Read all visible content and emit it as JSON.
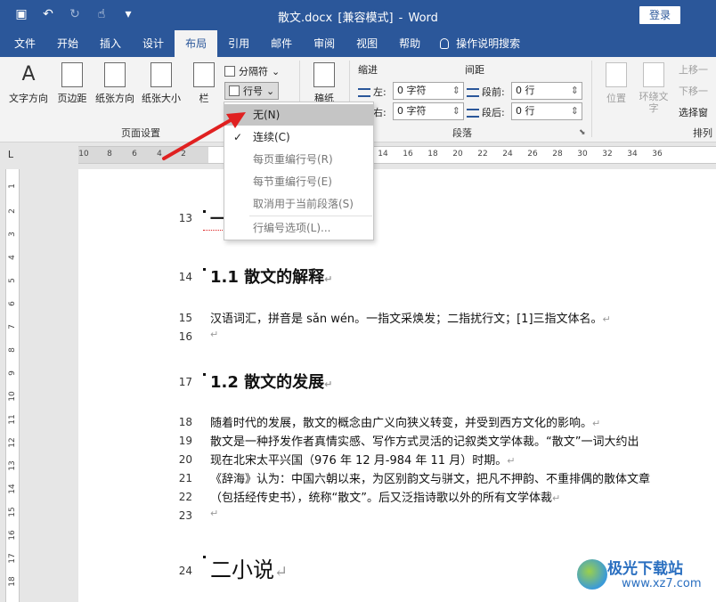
{
  "titlebar": {
    "doc_name": "散文.docx",
    "mode": "[兼容模式]",
    "separator": "-",
    "app": "Word",
    "login": "登录"
  },
  "tabs": [
    "文件",
    "开始",
    "插入",
    "设计",
    "布局",
    "引用",
    "邮件",
    "审阅",
    "视图",
    "帮助"
  ],
  "tab_search": "操作说明搜索",
  "ribbon": {
    "text_direction": "文字方向",
    "margins": "页边距",
    "orientation": "纸张方向",
    "size": "纸张大小",
    "columns": "栏",
    "breaks": "分隔符",
    "line_numbers": "行号",
    "hyphen_partial": "稿纸",
    "page_setup_label": "页面设置",
    "indent_label": "缩进",
    "spacing_label": "间距",
    "left_label": "左:",
    "right_label": "右:",
    "before_label": "段前:",
    "after_label": "段后:",
    "left_value": "0 字符",
    "right_value": "0 字符",
    "before_value": "0 行",
    "after_value": "0 行",
    "paragraph_label": "段落",
    "position": "位置",
    "wrap_text": "环绕文字",
    "bring_forward": "上移一",
    "send_backward": "下移一",
    "selection_pane": "选择窗",
    "arrange_label": "排列"
  },
  "ruler": {
    "corner": "L",
    "ticks": [
      "10",
      "8",
      "6",
      "4",
      "2",
      "14",
      "16",
      "18",
      "20",
      "22",
      "24",
      "26",
      "28",
      "30",
      "32",
      "34",
      "36"
    ],
    "vticks": [
      "1",
      "2",
      "3",
      "4",
      "5",
      "6",
      "7",
      "8",
      "9",
      "10",
      "11",
      "12",
      "13",
      "14",
      "15",
      "16",
      "17",
      "18",
      "19"
    ]
  },
  "dropdown": {
    "items": [
      {
        "label": "无(N)",
        "checked": false
      },
      {
        "label": "连续(C)",
        "checked": true
      },
      {
        "label": "每页重编行号(R)",
        "checked": false
      },
      {
        "label": "每节重编行号(E)",
        "checked": false
      },
      {
        "label": "取消用于当前段落(S)",
        "checked": false
      },
      {
        "label": "行编号选项(L)...",
        "checked": false
      }
    ]
  },
  "document": {
    "ln13": "13",
    "h13_partial": "一",
    "ln14": "14",
    "h14": "1.1 散文的解释",
    "ln15": "15",
    "p15": "汉语词汇，拼音是 sǎn wén。一指文采焕发；二指扰行文；[1]三指文体名。",
    "ln16": "16",
    "ln17": "17",
    "h17": "1.2 散文的发展",
    "ln18": "18",
    "p18": "随着时代的发展，散文的概念由广义向狭义转变，并受到西方文化的影响。",
    "ln19": "19",
    "p19": "散文是一种抒发作者真情实感、写作方式灵活的记叙类文学体裁。“散文”一词大约出",
    "ln20": "20",
    "p20": "现在北宋太平兴国（976 年 12 月-984 年 11 月）时期。",
    "ln21": "21",
    "p21": "《辞海》认为：中国六朝以来，为区别韵文与骈文，把凡不押韵、不重排偶的散体文章",
    "ln22": "22",
    "p22": "（包括经传史书），统称“散文”。后又泛指诗歌以外的所有文学体裁",
    "ln23": "23",
    "ln24": "24",
    "h24": "二小说",
    "para_mark": "↵"
  },
  "watermark": {
    "name": "极光下载站",
    "url": "www.xz7.com"
  },
  "colors": {
    "brand": "#2b579a",
    "arrow": "#e02020"
  }
}
